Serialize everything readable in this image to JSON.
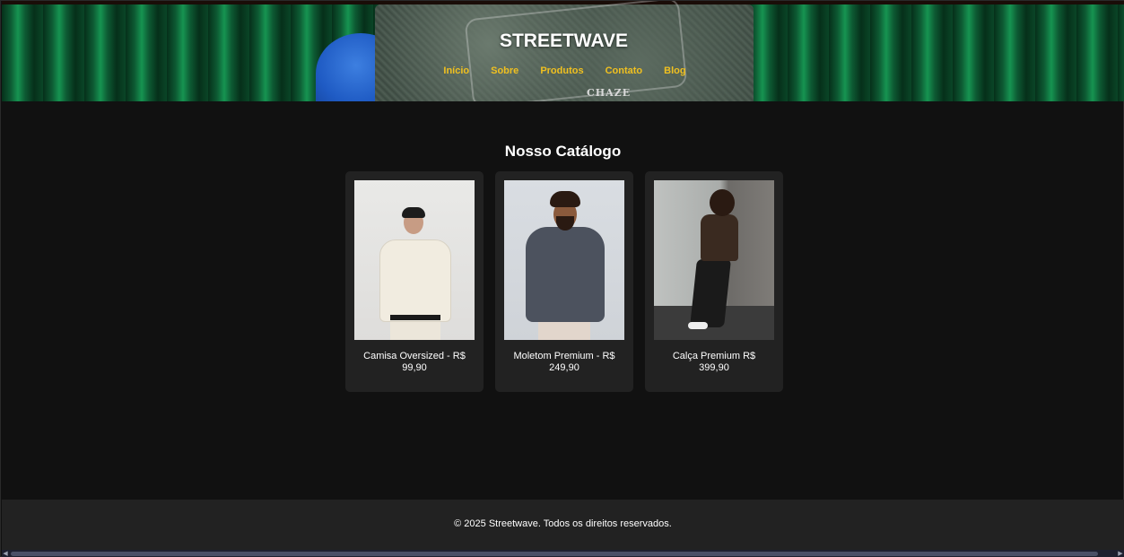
{
  "header": {
    "brand": "STREETWAVE",
    "hero_print_tag": "CHAZE",
    "nav": [
      {
        "label": "Início"
      },
      {
        "label": "Sobre"
      },
      {
        "label": "Produtos"
      },
      {
        "label": "Contato"
      },
      {
        "label": "Blog"
      }
    ]
  },
  "main": {
    "section_title": "Nosso Catálogo",
    "products": [
      {
        "caption": "Camisa Oversized - R$ 99,90"
      },
      {
        "caption": "Moletom Premium - R$ 249,90"
      },
      {
        "caption": "Calça Premium R$ 399,90"
      }
    ]
  },
  "footer": {
    "text": "© 2025 Streetwave. Todos os direitos reservados."
  },
  "colors": {
    "background": "#111111",
    "card": "#222222",
    "nav_link": "#f0c020",
    "text": "#ffffff"
  }
}
